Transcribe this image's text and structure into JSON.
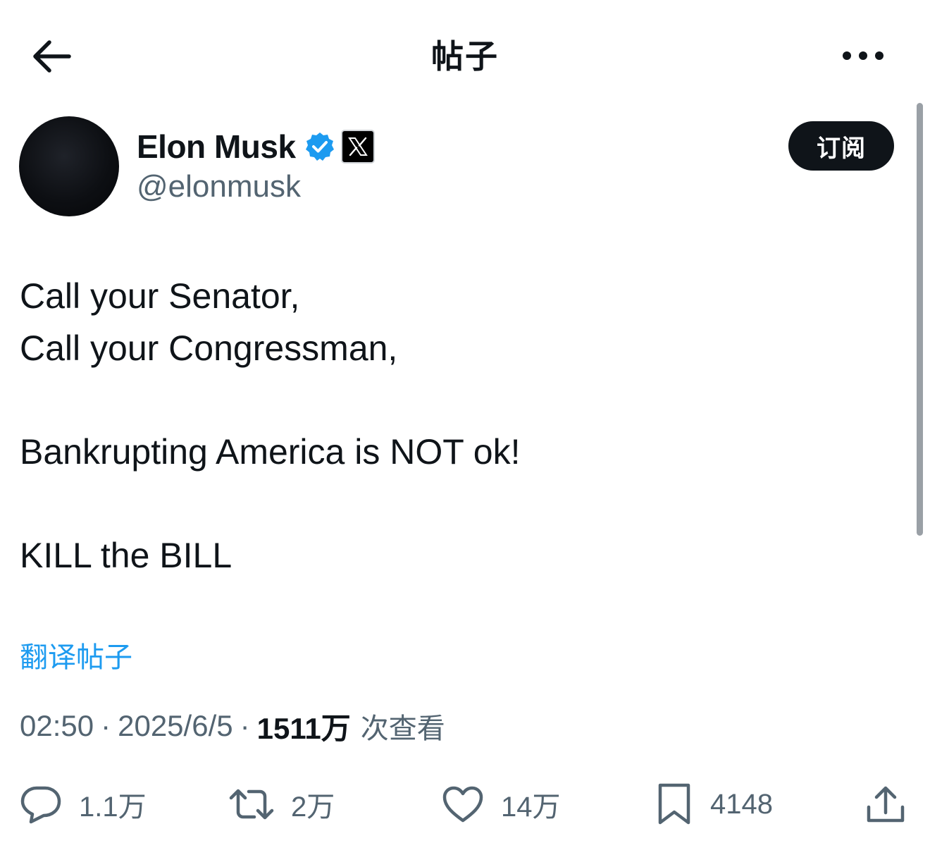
{
  "header": {
    "title": "帖子",
    "back_icon": "arrow-left-icon",
    "more_icon": "more-horizontal-icon"
  },
  "author": {
    "name": "Elon Musk",
    "handle": "@elonmusk",
    "verified": true,
    "verified_color": "#1d9bf0",
    "affiliate_badge": "x-logo-icon"
  },
  "subscribe": {
    "label": "订阅"
  },
  "post": {
    "lines": [
      "Call your Senator,",
      "Call your Congressman,",
      "Bankrupting America is NOT ok!",
      "KILL the BILL"
    ]
  },
  "translate": {
    "label": "翻译帖子"
  },
  "meta": {
    "time": "02:50",
    "date": "2025/6/5",
    "separator": "·",
    "views_count": "1511万",
    "views_label": "次查看"
  },
  "actions": {
    "reply": {
      "icon": "reply-icon",
      "count": "1.1万"
    },
    "repost": {
      "icon": "repost-icon",
      "count": "2万"
    },
    "like": {
      "icon": "heart-icon",
      "count": "14万"
    },
    "bookmark": {
      "icon": "bookmark-icon",
      "count": "4148"
    },
    "share": {
      "icon": "share-icon"
    }
  },
  "colors": {
    "text_primary": "#0f1419",
    "text_secondary": "#536471",
    "link": "#1d9bf0"
  }
}
